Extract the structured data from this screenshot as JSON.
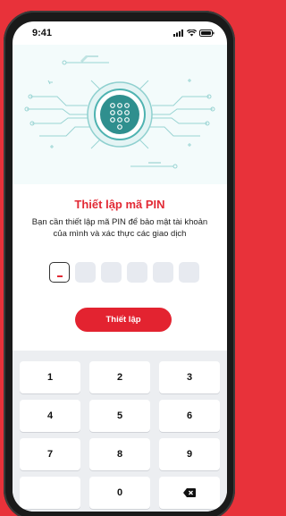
{
  "status_bar": {
    "time": "9:41"
  },
  "setup": {
    "title": "Thiết lập mã PIN",
    "description": "Bạn cần thiết lập mã PIN để bảo mật tài khoản của mình và xác thực các giao dịch",
    "pin_length": 6,
    "active_index": 0,
    "submit_label": "Thiết lập"
  },
  "keypad": {
    "keys": [
      "1",
      "2",
      "3",
      "4",
      "5",
      "6",
      "7",
      "8",
      "9",
      "",
      "0",
      "backspace-icon"
    ]
  },
  "colors": {
    "accent": "#e32330",
    "background": "#e8323a",
    "keypad_bg": "#eceef1"
  }
}
